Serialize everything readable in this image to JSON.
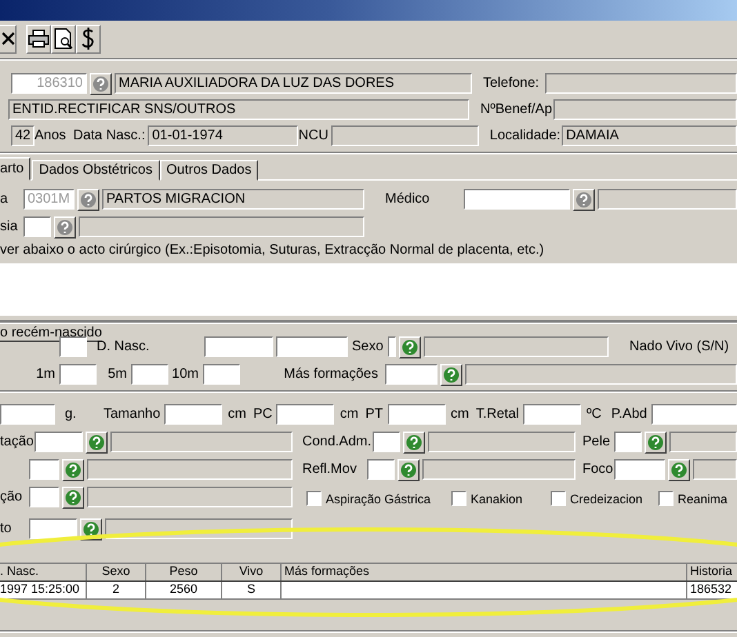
{
  "patient": {
    "process_number": "186310",
    "name": "MARIA AUXILIADORA DA LUZ DAS DORES",
    "phone_label": "Telefone:",
    "entity": "ENTID.RECTIFICAR SNS/OUTROS",
    "benef_label": "NºBenef/Ap",
    "age": "42",
    "age_unit": "Anos",
    "birth_label": "Data Nasc.:",
    "birth_date": "01-01-1974",
    "ncu_label": "NCU",
    "locality_label": "Localidade:",
    "locality": "DAMAIA"
  },
  "tabs": [
    {
      "label": "arto",
      "selected": true
    },
    {
      "label": "Dados Obstétricos",
      "selected": false
    },
    {
      "label": "Outros Dados",
      "selected": false
    }
  ],
  "delivery": {
    "type_label": "a",
    "type_code": "0301M",
    "type_name": "PARTOS MIGRACION",
    "doctor_label": "Médico",
    "anesthesia_label": "sia",
    "note": "ver abaixo o acto cirúrgico (Ex.:Episotomia, Suturas, Extracção Normal de placenta, etc.)"
  },
  "newborn": {
    "group_title": "o recém-nascido",
    "birth_label": "D. Nasc.",
    "sex_label": "Sexo",
    "alive_label": "Nado Vivo (S/N)",
    "apgar": [
      "1m",
      "5m",
      "10m"
    ],
    "malformations_label": "Más formações",
    "weight_unit": "g.",
    "measures": [
      {
        "label": "Tamanho",
        "unit": "cm"
      },
      {
        "label": "PC",
        "unit": "cm"
      },
      {
        "label": "PT",
        "unit": "cm"
      },
      {
        "label": "T.Retal",
        "unit": "ºC"
      }
    ],
    "abd_label": "P.Abd",
    "left_lookups": [
      {
        "kind": "labeled",
        "label": "tação"
      },
      {
        "kind": "unlabeled"
      },
      {
        "kind": "labeled",
        "label": "ção"
      },
      {
        "kind": "labeled",
        "label": "to"
      }
    ],
    "mid_lookups": [
      {
        "label": "Cond.Adm."
      },
      {
        "label": "Refl.Mov"
      }
    ],
    "right_lookups": [
      {
        "label": "Pele"
      },
      {
        "label": "Foco"
      }
    ],
    "checks": [
      {
        "label": "Aspiração Gástrica",
        "checked": false
      },
      {
        "label": "Kanakion",
        "checked": false
      },
      {
        "label": "Credeizacion",
        "checked": false
      },
      {
        "label": "Reanima",
        "checked": false
      }
    ]
  },
  "table": {
    "columns": [
      ". Nasc.",
      "Sexo",
      "Peso",
      "Vivo",
      "Más formações",
      "Historia"
    ],
    "rows": [
      {
        "cells": [
          "1997 15:25:00",
          "2",
          "2560",
          "S",
          null,
          "186532"
        ]
      }
    ]
  }
}
